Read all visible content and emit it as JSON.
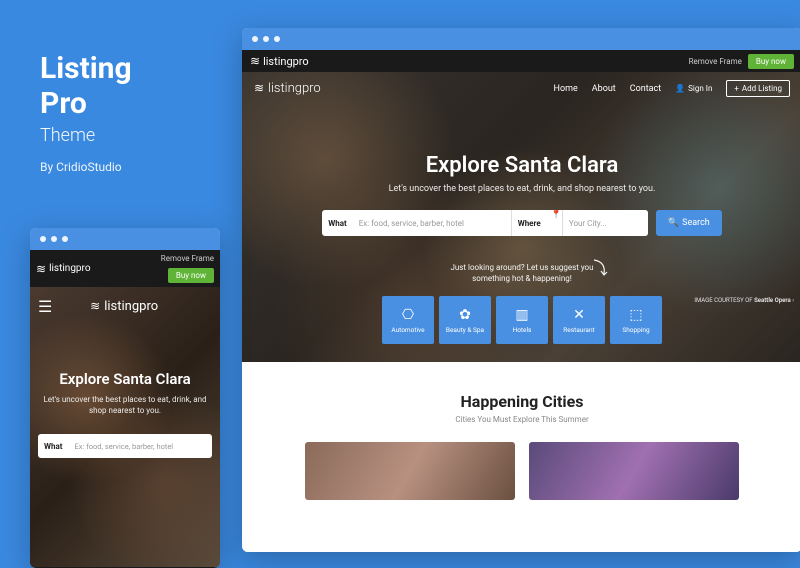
{
  "title_block": {
    "line1": "Listing",
    "line2": "Pro",
    "subtitle": "Theme",
    "byline": "By CridioStudio"
  },
  "brand": "listingpro",
  "topstrip": {
    "remove_frame": "Remove Frame",
    "buy_now": "Buy now"
  },
  "nav": {
    "home": "Home",
    "about": "About",
    "contact": "Contact",
    "signin": "Sign In",
    "add_listing": "Add Listing"
  },
  "hero": {
    "heading": "Explore Santa Clara",
    "subheading": "Let's uncover the best places to eat, drink, and shop nearest to you.",
    "what_label": "What",
    "what_placeholder": "Ex: food, service, barber, hotel",
    "where_label": "Where",
    "where_placeholder": "Your City...",
    "search": "Search",
    "suggest_l1": "Just looking around? Let us suggest you",
    "suggest_l2": "something hot & happening!",
    "credit_prefix": "IMAGE COURTESY OF",
    "credit_name": "Seattle Opera"
  },
  "categories": [
    {
      "icon": "⎔",
      "label": "Automotive"
    },
    {
      "icon": "✿",
      "label": "Beauty & Spa"
    },
    {
      "icon": "▥",
      "label": "Hotels"
    },
    {
      "icon": "✕",
      "label": "Restaurant"
    },
    {
      "icon": "⬚",
      "label": "Shopping"
    }
  ],
  "section2": {
    "heading": "Happening Cities",
    "sub": "Cities You Must Explore This Summer"
  },
  "mobile": {
    "heading": "Explore Santa Clara",
    "sub": "Let's uncover the best places to eat, drink, and shop nearest to you."
  }
}
